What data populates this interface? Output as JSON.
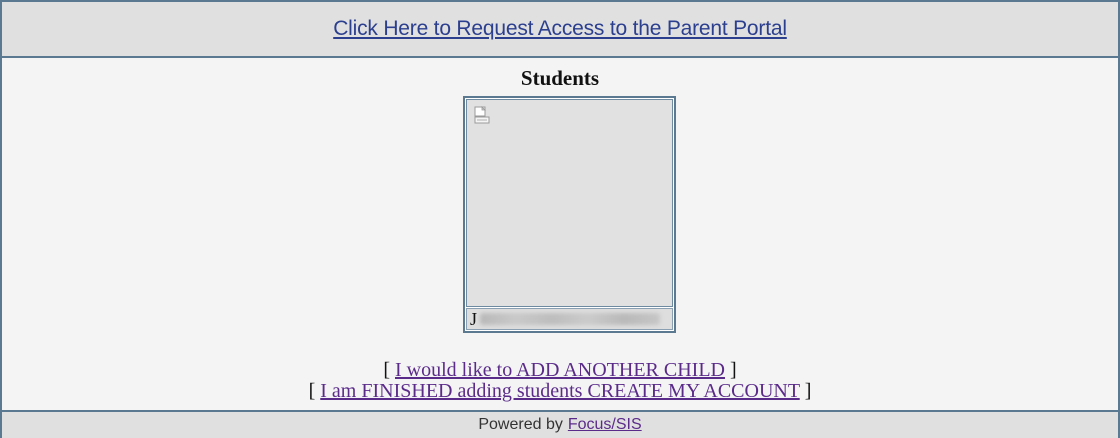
{
  "header": {
    "request_access_link": "Click Here to Request Access to the Parent Portal"
  },
  "students": {
    "heading": "Students",
    "cards": [
      {
        "name_initial": "J",
        "photo_icon": "broken-image-icon"
      }
    ]
  },
  "actions": {
    "open_bracket": "[",
    "close_bracket": "]",
    "add_child_label": "I would like to ADD ANOTHER CHILD",
    "finish_label": "I am FINISHED adding students CREATE MY ACCOUNT"
  },
  "footer": {
    "powered_by": "Powered by",
    "vendor_link": "Focus/SIS"
  },
  "colors": {
    "border": "#5b7a92",
    "link_primary": "#2c3f8f",
    "link_visited": "#5b2b8a",
    "bar_background": "#e0e0e0"
  }
}
